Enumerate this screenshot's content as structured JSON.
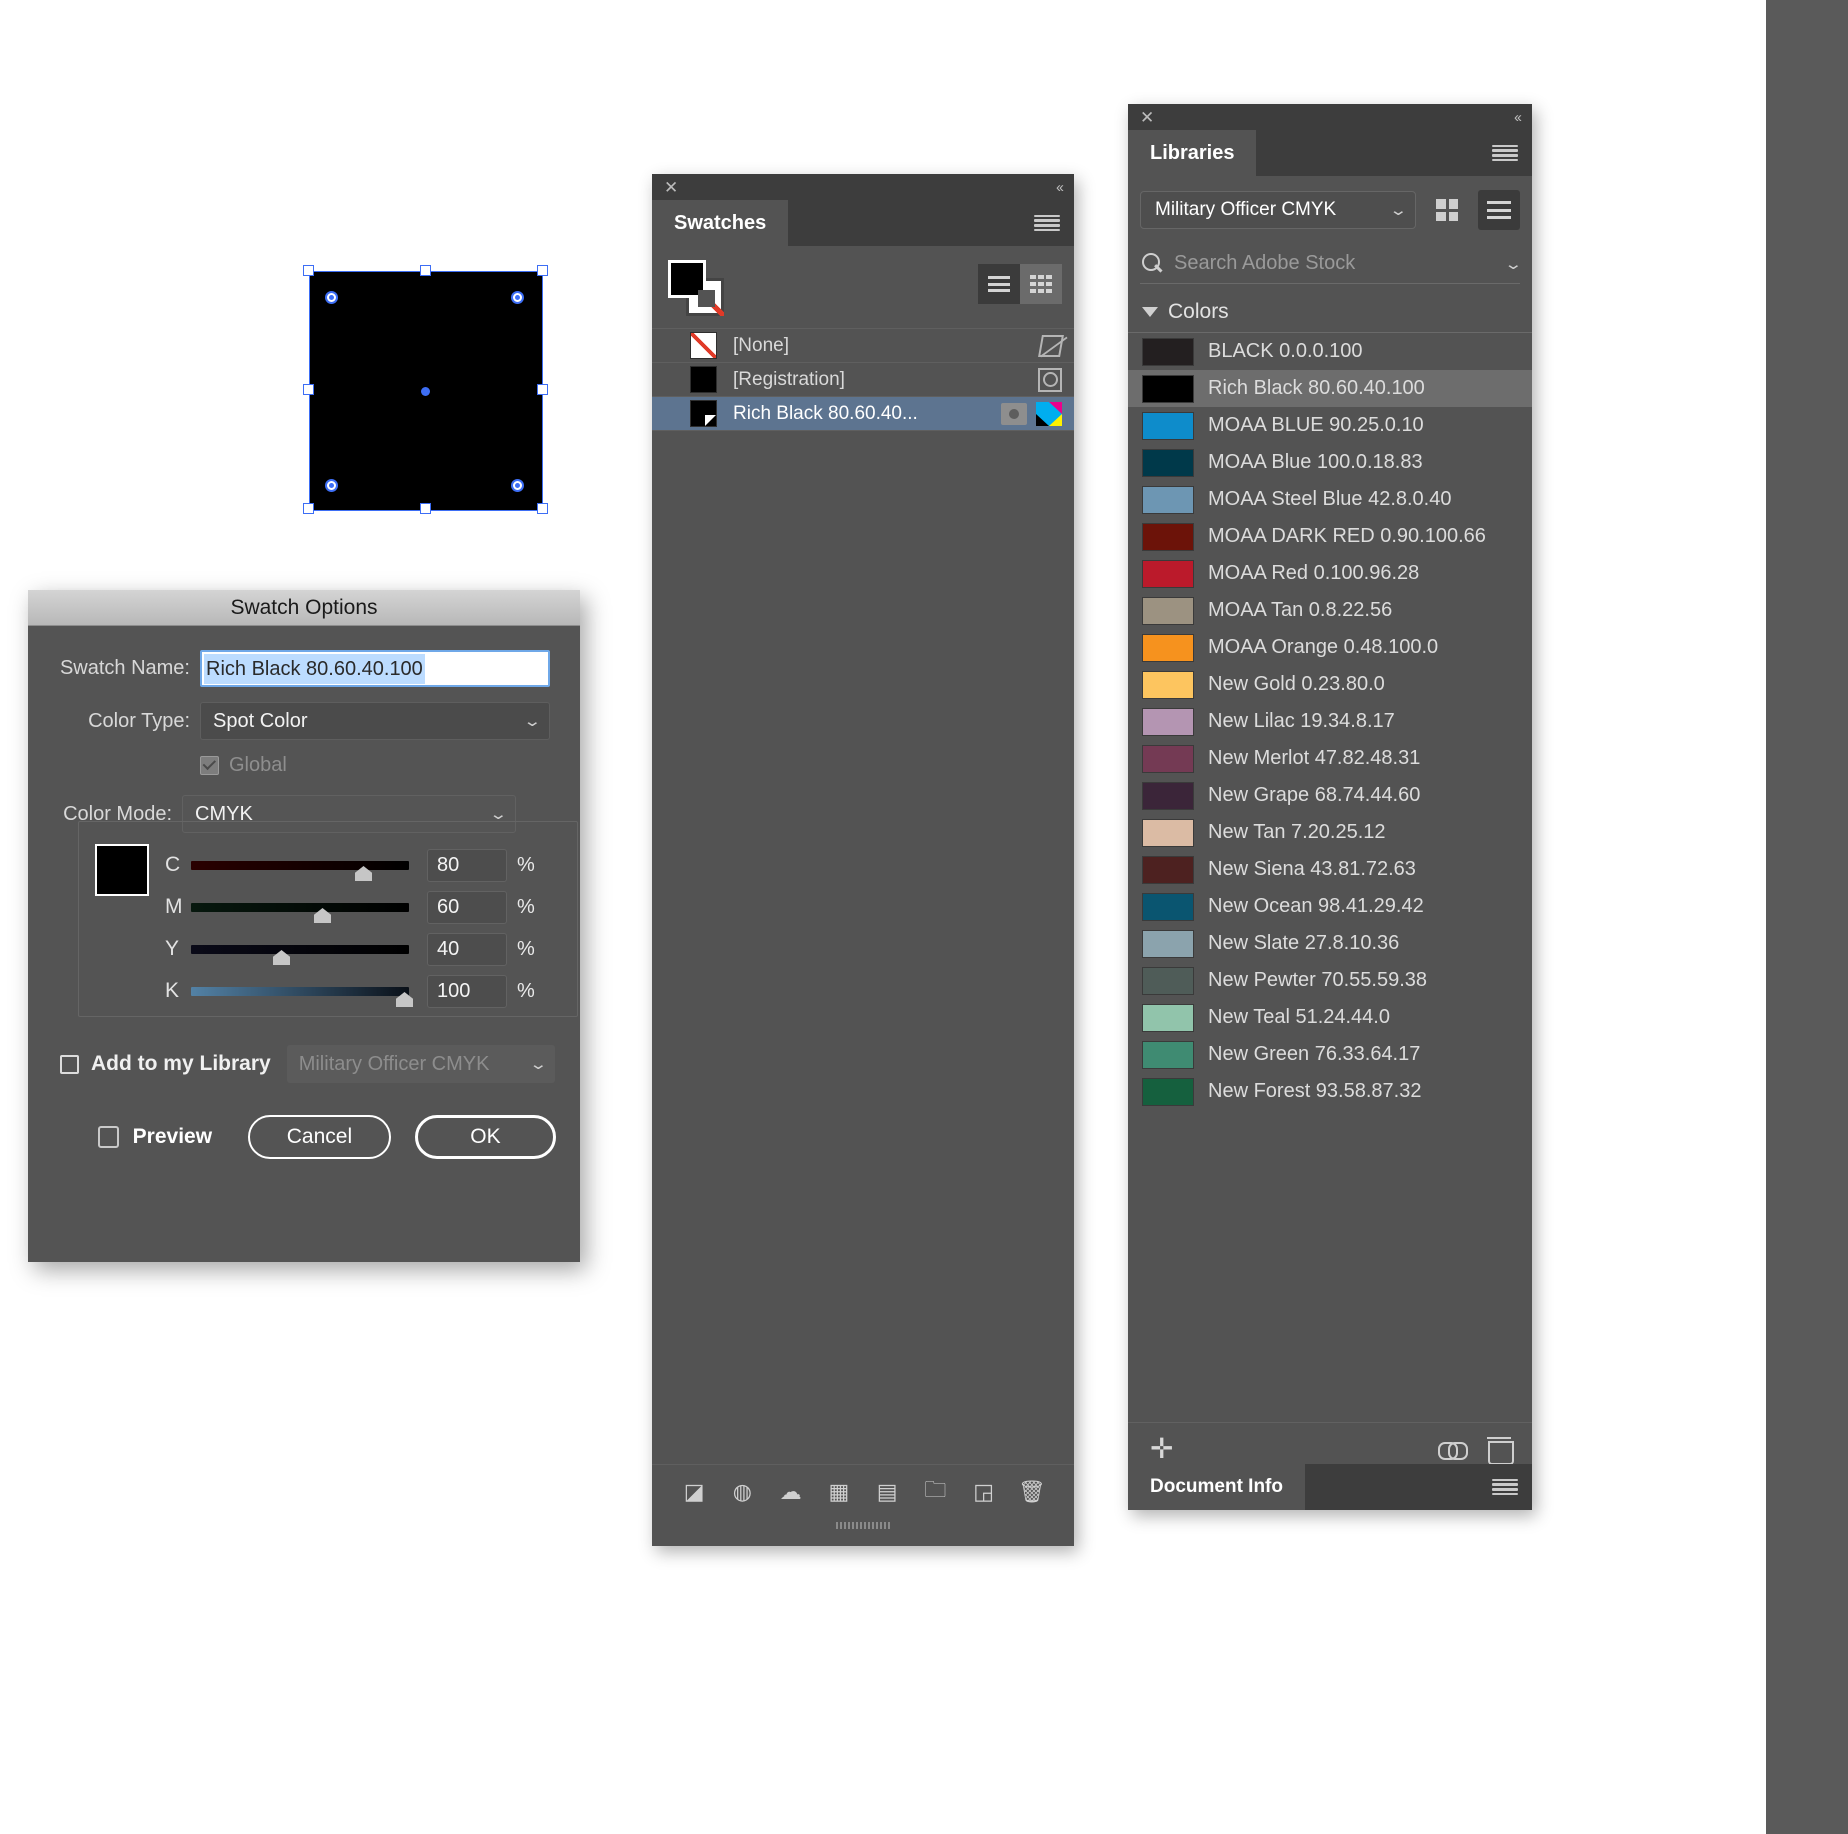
{
  "canvas": {
    "object_fill": "#000000",
    "selection_color": "#3d6ef5"
  },
  "dialog": {
    "title": "Swatch Options",
    "swatch_name_label": "Swatch Name:",
    "swatch_name_value": "Rich Black 80.60.40.100",
    "color_type_label": "Color Type:",
    "color_type_value": "Spot Color",
    "global_label": "Global",
    "global_checked": true,
    "color_mode_label": "Color Mode:",
    "color_mode_value": "CMYK",
    "preview_color": "#000000",
    "channels": [
      {
        "name": "C",
        "value": "80",
        "unit": "%",
        "pct": 80
      },
      {
        "name": "M",
        "value": "60",
        "unit": "%",
        "pct": 60
      },
      {
        "name": "Y",
        "value": "40",
        "unit": "%",
        "pct": 40
      },
      {
        "name": "K",
        "value": "100",
        "unit": "%",
        "pct": 100
      }
    ],
    "add_to_library_label": "Add to my Library",
    "add_to_library_checked": false,
    "library_select_value": "Military Officer CMYK",
    "preview_label": "Preview",
    "preview_checked": false,
    "cancel_label": "Cancel",
    "ok_label": "OK"
  },
  "swatches_panel": {
    "tab_label": "Swatches",
    "close_icon": "close-icon",
    "collapse_icon": "collapse-icon",
    "menu_icon": "panel-menu-icon",
    "fill_color": "#000000",
    "stroke_color": "none",
    "view_list_icon": "list-view-icon",
    "view_grid_icon": "grid-view-icon",
    "rows": [
      {
        "name": "[None]",
        "chip": "none",
        "selected": false,
        "icons": [
          "none-icon"
        ]
      },
      {
        "name": "[Registration]",
        "chip": "black",
        "selected": false,
        "icons": [
          "registration-icon"
        ]
      },
      {
        "name": "Rich Black 80.60.40...",
        "chip": "spot",
        "selected": true,
        "icons": [
          "spot-color-icon",
          "cmyk-icon"
        ]
      }
    ],
    "footer_icons": [
      "swatch-libraries-icon",
      "color-group-link-icon",
      "color-themes-icon",
      "show-swatch-kinds-icon",
      "swatch-options-icon",
      "new-color-group-icon",
      "new-swatch-icon",
      "delete-swatch-icon"
    ]
  },
  "libraries_panel": {
    "tab_label": "Libraries",
    "close_icon": "close-icon",
    "collapse_icon": "collapse-icon",
    "menu_icon": "panel-menu-icon",
    "library_select_value": "Military Officer CMYK",
    "view_grid_icon": "grid-view-icon",
    "view_list_icon": "list-view-icon",
    "search_placeholder": "Search Adobe Stock",
    "search_value": "",
    "search_chevron_icon": "chevron-down-icon",
    "section_label": "Colors",
    "section_expanded": true,
    "colors": [
      {
        "name": "BLACK 0.0.0.100",
        "hex": "#231f20",
        "selected": false
      },
      {
        "name": "Rich Black 80.60.40.100",
        "hex": "#000000",
        "selected": true
      },
      {
        "name": "MOAA BLUE 90.25.0.10",
        "hex": "#0e8ccb",
        "selected": false
      },
      {
        "name": "MOAA Blue 100.0.18.83",
        "hex": "#00394a",
        "selected": false
      },
      {
        "name": "MOAA Steel Blue 42.8.0.40",
        "hex": "#6d96b3",
        "selected": false
      },
      {
        "name": "MOAA DARK RED 0.90.100.66",
        "hex": "#6c1309",
        "selected": false
      },
      {
        "name": "MOAA Red 0.100.96.28",
        "hex": "#bb1a2b",
        "selected": false
      },
      {
        "name": "MOAA Tan 0.8.22.56",
        "hex": "#9c9281",
        "selected": false
      },
      {
        "name": "MOAA Orange 0.48.100.0",
        "hex": "#f6921e",
        "selected": false
      },
      {
        "name": "New Gold 0.23.80.0",
        "hex": "#fdc košik",
        "selected": false
      },
      {
        "name": "New Lilac 19.34.8.17",
        "hex": "#b495b2",
        "selected": false
      },
      {
        "name": "New Merlot 47.82.48.31",
        "hex": "#743a54",
        "selected": false
      },
      {
        "name": "New Grape 68.74.44.60",
        "hex": "#3b2539",
        "selected": false
      },
      {
        "name": "New Tan 7.20.25.12",
        "hex": "#dbbba4",
        "selected": false
      },
      {
        "name": "New Siena 43.81.72.63",
        "hex": "#4d2120",
        "selected": false
      },
      {
        "name": "New Ocean 98.41.29.42",
        "hex": "#0a5570",
        "selected": false
      },
      {
        "name": "New Slate 27.8.10.36",
        "hex": "#8ba3ad",
        "selected": false
      },
      {
        "name": "New Pewter 70.55.59.38",
        "hex": "#4f5c58",
        "selected": false
      },
      {
        "name": "New Teal 51.24.44.0",
        "hex": "#91c4ab",
        "selected": false
      },
      {
        "name": "New Green 76.33.64.17",
        "hex": "#3f8b72",
        "selected": false
      },
      {
        "name": "New Forest 93.58.87.32",
        "hex": "#15603e",
        "selected": false
      }
    ],
    "add_icon": "add-item-icon",
    "link_icon": "share-link-icon",
    "delete_icon": "trash-icon",
    "document_info_tab": "Document Info"
  }
}
